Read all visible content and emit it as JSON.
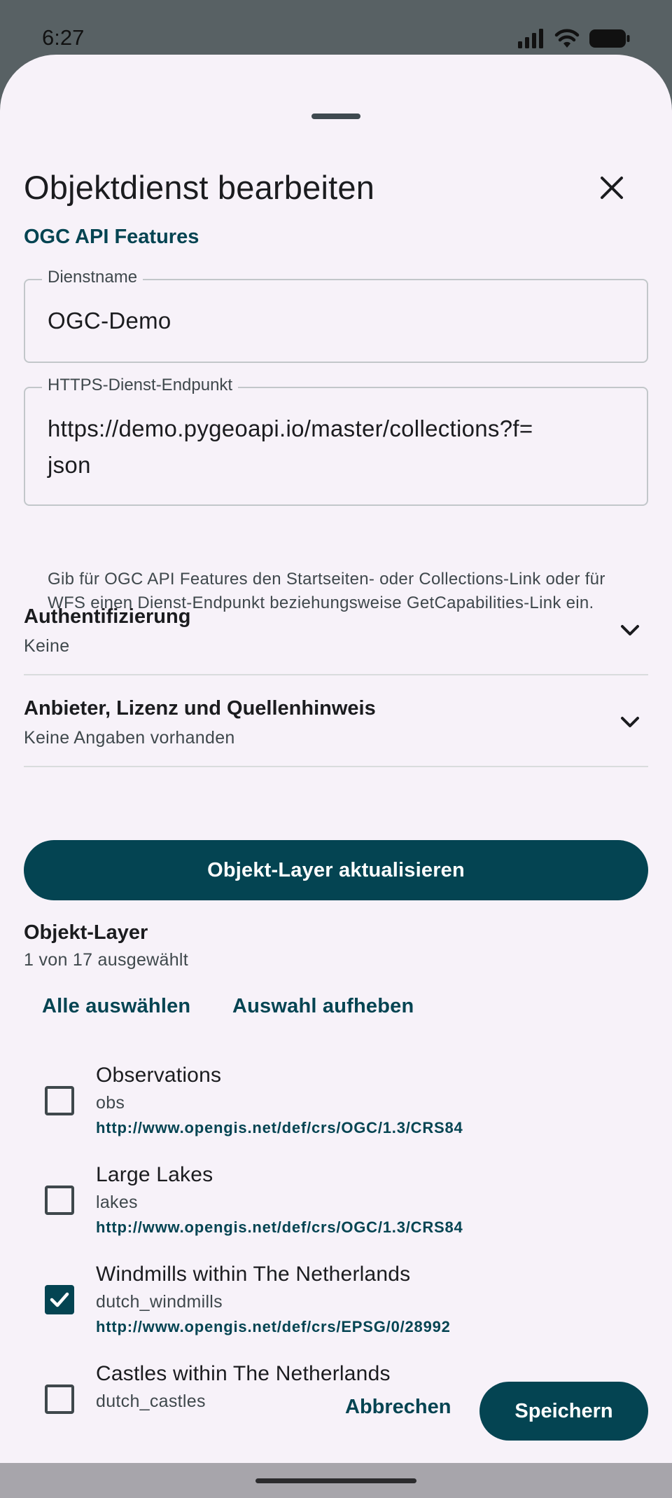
{
  "status_bar": {
    "time": "6:27",
    "icons": [
      "signal-icon",
      "wifi-icon",
      "battery-icon"
    ]
  },
  "dialog": {
    "title": "Objektdienst bearbeiten",
    "close_icon": "close-icon",
    "service_type": "OGC API Features"
  },
  "fields": {
    "service_name": {
      "label": "Dienstname",
      "value": "OGC-Demo"
    },
    "endpoint": {
      "label": "HTTPS-Dienst-Endpunkt",
      "value_line1": "https://demo.pygeoapi.io/master/collections?f=",
      "value_line2": "json",
      "helper": "Gib für OGC API Features den Startseiten- oder Collections-Link oder für WFS einen Dienst-Endpunkt beziehungsweise GetCapabilities-Link ein."
    }
  },
  "expanders": {
    "auth": {
      "title": "Authentifizierung",
      "value": "Keine"
    },
    "provider": {
      "title": "Anbieter, Lizenz und Quellenhinweis",
      "value": "Keine Angaben vorhanden"
    }
  },
  "refresh_button": "Objekt-Layer aktualisieren",
  "layers_section": {
    "title": "Objekt-Layer",
    "count": "1 von 17 ausgewählt",
    "select_all": "Alle auswählen",
    "deselect_all": "Auswahl aufheben",
    "items": [
      {
        "name": "Observations",
        "id": "obs",
        "crs": "http://www.opengis.net/def/crs/OGC/1.3/CRS84",
        "checked": false
      },
      {
        "name": "Large Lakes",
        "id": "lakes",
        "crs": "http://www.opengis.net/def/crs/OGC/1.3/CRS84",
        "checked": false
      },
      {
        "name": "Windmills within The Netherlands",
        "id": "dutch_windmills",
        "crs": "http://www.opengis.net/def/crs/EPSG/0/28992",
        "checked": true
      },
      {
        "name": "Castles within The Netherlands",
        "id": "dutch_castles",
        "crs": "",
        "checked": false
      }
    ]
  },
  "actions": {
    "cancel": "Abbrechen",
    "save": "Speichern"
  },
  "colors": {
    "primary": "#044452",
    "sheet_background": "#f7f2f9",
    "scrim": "#586164"
  }
}
